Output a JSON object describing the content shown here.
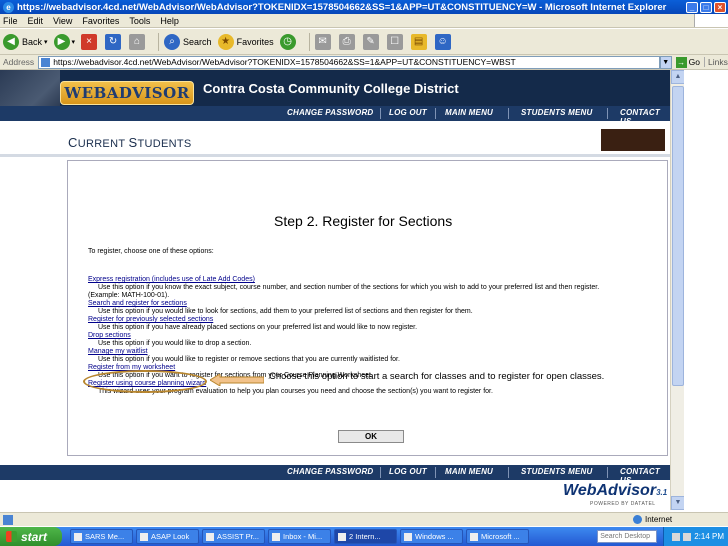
{
  "window": {
    "title": "https://webadvisor.4cd.net/WebAdvisor/WebAdvisor?TOKENIDX=1578504662&SS=1&APP=UT&CONSTITUENCY=W - Microsoft Internet Explorer"
  },
  "menu": [
    "File",
    "Edit",
    "View",
    "Favorites",
    "Tools",
    "Help"
  ],
  "toolbar": {
    "back": "Back",
    "search": "Search",
    "favorites": "Favorites"
  },
  "address": {
    "label": "Address",
    "url": "https://webadvisor.4cd.net/WebAdvisor/WebAdvisor?TOKENIDX=1578504662&SS=1&APP=UT&CONSTITUENCY=WBST",
    "go": "Go",
    "links": "Links"
  },
  "site": {
    "logo": "WEBADVISOR",
    "district": "Contra Costa Community College District",
    "nav": [
      "CHANGE PASSWORD",
      "LOG OUT",
      "MAIN MENU",
      "STUDENTS MENU",
      "CONTACT US"
    ],
    "section_title_c": "C",
    "section_title_1": "URRENT ",
    "section_title_s": "S",
    "section_title_2": "TUDENTS"
  },
  "main": {
    "step_title": "Step 2. Register for Sections",
    "intro": "To register, choose one of these options:",
    "options": [
      {
        "link": "Express registration (includes use of Late Add Codes)",
        "desc": "Use this option if you know the exact subject, course number, and section number of the sections for which you wish to add to your preferred list and then register.",
        "extra": "(Example: MATH-100-01)."
      },
      {
        "link": "Search and register for sections",
        "desc": "Use this option if you would like to look for sections, add them to your preferred list of sections and then register for them."
      },
      {
        "link": "Register for previously selected sections",
        "desc": "Use this option if you have already placed sections on your preferred list and would like to now register."
      },
      {
        "link": "Drop sections",
        "desc": "Use this option if you would like to drop a section."
      },
      {
        "link": "Manage my waitlist",
        "desc": "Use this option if you would like to register or remove sections that you are currently waitlisted for."
      },
      {
        "link": "Register from my worksheet",
        "desc": "Use this option if you want to register for sections from your Course Planning Worksheet."
      },
      {
        "link": "Register using course planning wizard",
        "desc": "This wizard uses your program evaluation to help you plan courses you need and choose the section(s) you want to register for."
      }
    ],
    "callout": "Choose this option to start a search for classes and to register for open classes.",
    "ok": "OK"
  },
  "footer": {
    "logo": "WebAdvisor",
    "version": "3.1",
    "powered": "POWERED BY DATATEL"
  },
  "status": {
    "zone": "Internet"
  },
  "taskbar": {
    "start": "start",
    "tasks": [
      "SARS Me...",
      "ASAP Look",
      "ASSIST Pr...",
      "Inbox - Mi...",
      "2 Intern...",
      "Windows ...",
      "Microsoft ..."
    ],
    "search_placeholder": "Search Desktop",
    "clock": "2:14 PM"
  },
  "colors": {
    "header_navy": "#142a4a",
    "nav_blue": "#1d3a66",
    "logo_gold": "#e2a52c",
    "link": "#00008b",
    "callout_oval": "#b8862e"
  }
}
